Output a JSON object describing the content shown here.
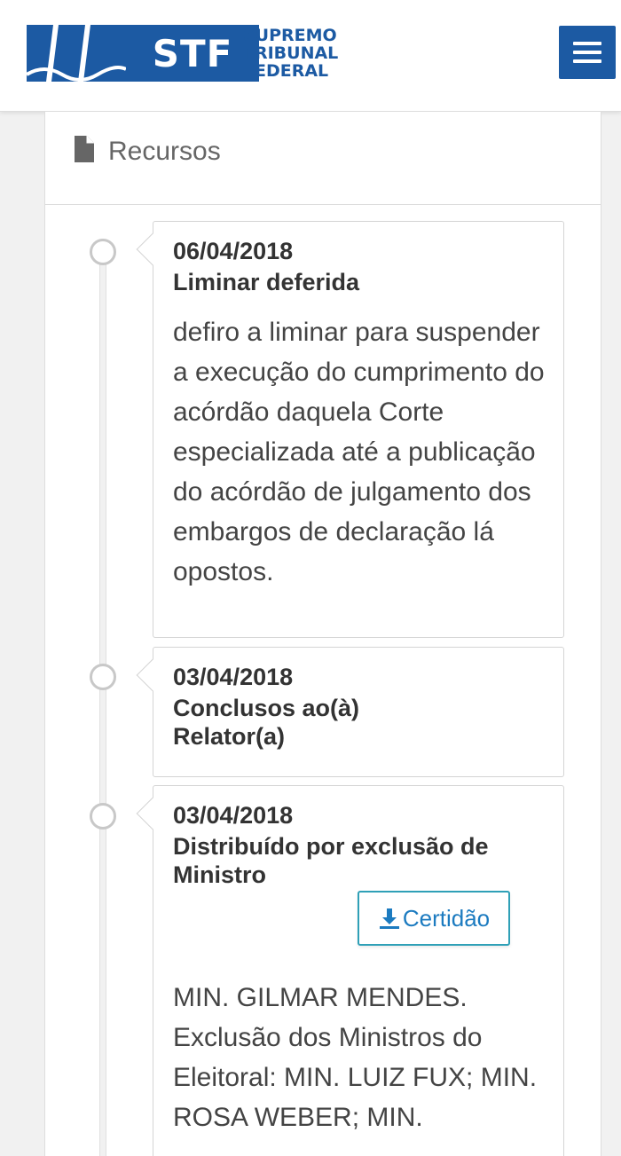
{
  "header": {
    "logo": {
      "abbr": "STF",
      "line1": "SUPREMO",
      "line2": "TRIBUNAL",
      "line3": "FEDERAL"
    },
    "menu_icon": "hamburger-menu-icon",
    "brand_color": "#1c5aa3"
  },
  "section": {
    "title": "Recursos",
    "icon": "file-icon"
  },
  "timeline": [
    {
      "date": "06/04/2018",
      "title": "Liminar deferida",
      "body": "defiro a liminar para suspender a execução do cumprimento do acórdão daquela Corte especializada até a publicação do acórdão de julgamento dos embargos de declaração lá opostos."
    },
    {
      "date": "03/04/2018",
      "title": "Conclusos ao(à) Relator(a)",
      "body": ""
    },
    {
      "date": "03/04/2018",
      "title": "Distribuído por exclusão de Ministro",
      "button_label": "Certidão",
      "button_icon": "download-icon",
      "body": "MIN. GILMAR MENDES. Exclusão dos Ministros do Eleitoral: MIN. LUIZ FUX; MIN. ROSA WEBER; MIN."
    }
  ]
}
